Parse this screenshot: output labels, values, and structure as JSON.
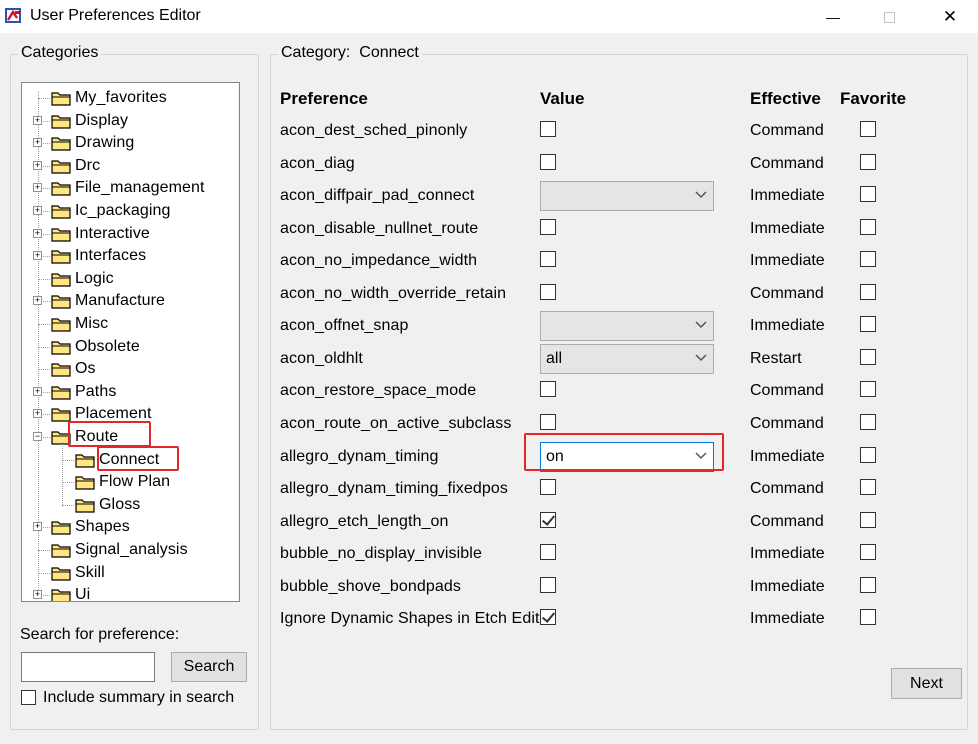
{
  "window": {
    "title": "User Preferences Editor",
    "min_glyph": "—",
    "close_glyph": "✕"
  },
  "categories": {
    "title": "Categories",
    "items": [
      {
        "label": "My_favorites",
        "expandable": false,
        "level": 0
      },
      {
        "label": "Display",
        "expandable": true,
        "level": 0
      },
      {
        "label": "Drawing",
        "expandable": true,
        "level": 0
      },
      {
        "label": "Drc",
        "expandable": true,
        "level": 0
      },
      {
        "label": "File_management",
        "expandable": true,
        "level": 0
      },
      {
        "label": "Ic_packaging",
        "expandable": true,
        "level": 0
      },
      {
        "label": "Interactive",
        "expandable": true,
        "level": 0
      },
      {
        "label": "Interfaces",
        "expandable": true,
        "level": 0
      },
      {
        "label": "Logic",
        "expandable": false,
        "level": 0
      },
      {
        "label": "Manufacture",
        "expandable": true,
        "level": 0
      },
      {
        "label": "Misc",
        "expandable": false,
        "level": 0
      },
      {
        "label": "Obsolete",
        "expandable": false,
        "level": 0
      },
      {
        "label": "Os",
        "expandable": false,
        "level": 0
      },
      {
        "label": "Paths",
        "expandable": true,
        "level": 0
      },
      {
        "label": "Placement",
        "expandable": true,
        "level": 0
      },
      {
        "label": "Route",
        "expandable": true,
        "expanded": true,
        "level": 0,
        "highlighted": true
      },
      {
        "label": "Connect",
        "expandable": false,
        "level": 1,
        "highlighted": true,
        "selected": true
      },
      {
        "label": "Flow Plan",
        "expandable": false,
        "level": 1
      },
      {
        "label": "Gloss",
        "expandable": false,
        "level": 1
      },
      {
        "label": "Shapes",
        "expandable": true,
        "level": 0
      },
      {
        "label": "Signal_analysis",
        "expandable": false,
        "level": 0
      },
      {
        "label": "Skill",
        "expandable": false,
        "level": 0
      },
      {
        "label": "Ui",
        "expandable": true,
        "level": 0
      }
    ]
  },
  "search": {
    "label": "Search for preference:",
    "value": "",
    "button": "Search",
    "include_summary_label": "Include summary in search",
    "include_summary_checked": false
  },
  "category_panel": {
    "title_prefix": "Category:",
    "title_value": "Connect",
    "headers": {
      "preference": "Preference",
      "value": "Value",
      "effective": "Effective",
      "favorite": "Favorite"
    },
    "rows": [
      {
        "name": "acon_dest_sched_pinonly",
        "type": "checkbox",
        "checked": false,
        "effective": "Command",
        "favorite": false
      },
      {
        "name": "acon_diag",
        "type": "checkbox",
        "checked": false,
        "effective": "Command",
        "favorite": false
      },
      {
        "name": "acon_diffpair_pad_connect",
        "type": "combo",
        "value": "",
        "effective": "Immediate",
        "favorite": false
      },
      {
        "name": "acon_disable_nullnet_route",
        "type": "checkbox",
        "checked": false,
        "effective": "Immediate",
        "favorite": false
      },
      {
        "name": "acon_no_impedance_width",
        "type": "checkbox",
        "checked": false,
        "effective": "Immediate",
        "favorite": false
      },
      {
        "name": "acon_no_width_override_retain",
        "type": "checkbox",
        "checked": false,
        "effective": "Command",
        "favorite": false
      },
      {
        "name": "acon_offnet_snap",
        "type": "combo",
        "value": "",
        "effective": "Immediate",
        "favorite": false
      },
      {
        "name": "acon_oldhlt",
        "type": "combo",
        "value": "all",
        "effective": "Restart",
        "favorite": false
      },
      {
        "name": "acon_restore_space_mode",
        "type": "checkbox",
        "checked": false,
        "effective": "Command",
        "favorite": false
      },
      {
        "name": "acon_route_on_active_subclass",
        "type": "checkbox",
        "checked": false,
        "effective": "Command",
        "favorite": false
      },
      {
        "name": "allegro_dynam_timing",
        "type": "combo",
        "value": "on",
        "active": true,
        "highlighted": true,
        "effective": "Immediate",
        "favorite": false
      },
      {
        "name": "allegro_dynam_timing_fixedpos",
        "type": "checkbox",
        "checked": false,
        "effective": "Command",
        "favorite": false
      },
      {
        "name": "allegro_etch_length_on",
        "type": "checkbox",
        "checked": true,
        "effective": "Command",
        "favorite": false
      },
      {
        "name": "bubble_no_display_invisible",
        "type": "checkbox",
        "checked": false,
        "effective": "Immediate",
        "favorite": false
      },
      {
        "name": "bubble_shove_bondpads",
        "type": "checkbox",
        "checked": false,
        "effective": "Immediate",
        "favorite": false
      },
      {
        "name": "Ignore Dynamic Shapes in Etch Edit",
        "type": "checkbox",
        "checked": true,
        "effective": "Immediate",
        "favorite": false
      }
    ],
    "next_button": "Next"
  },
  "colors": {
    "highlight_red": "#e8262a",
    "folder_yellow": "#ffe680",
    "focus_blue": "#0078d7"
  }
}
